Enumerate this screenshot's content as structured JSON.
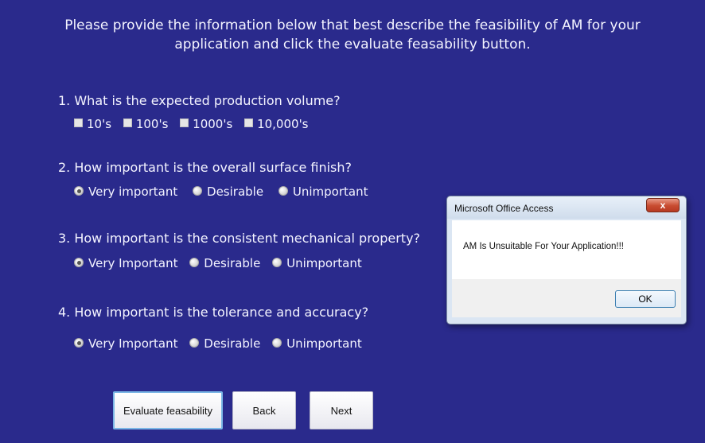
{
  "intro": {
    "line1": "Please provide the information below that best describe the feasibility of AM for your",
    "line2": "application and click the evaluate feasability button."
  },
  "questions": [
    {
      "text": "1. What is the expected production volume?",
      "type": "checkbox",
      "options": [
        "10's",
        "100's",
        "1000's",
        "10,000's"
      ]
    },
    {
      "text": "2. How important is the overall surface finish?",
      "type": "radio",
      "selected": "Very important",
      "options": [
        "Very important",
        "Desirable",
        "Unimportant"
      ]
    },
    {
      "text": "3. How important is the consistent mechanical property?",
      "type": "radio",
      "selected": "Very Important",
      "options": [
        "Very Important",
        "Desirable",
        "Unimportant"
      ]
    },
    {
      "text": "4. How important is the tolerance and accuracy?",
      "type": "radio",
      "selected": "Very Important",
      "options": [
        "Very Important",
        "Desirable",
        "Unimportant"
      ]
    }
  ],
  "buttons": {
    "evaluate": "Evaluate feasability",
    "back": "Back",
    "next": "Next"
  },
  "dialog": {
    "title": "Microsoft Office Access",
    "close": "x",
    "message": "AM Is Unsuitable For Your Application!!!",
    "ok": "OK"
  },
  "colors": {
    "background": "#2a2a8c",
    "text": "#f4f4ff",
    "dialog_close": "#c84b30"
  }
}
